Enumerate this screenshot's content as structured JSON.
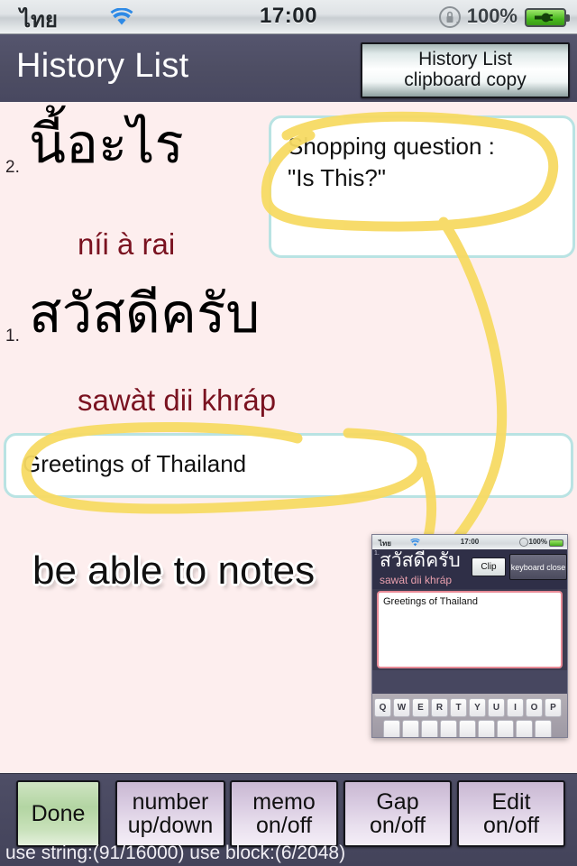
{
  "status_bar": {
    "language": "ไทย",
    "wifi_icon": "wifi-icon",
    "time": "17:00",
    "rotation_lock_icon": "rotation-lock-icon",
    "battery_percent": "100%",
    "battery_icon": "battery-charging-icon"
  },
  "nav": {
    "title": "History List",
    "clipboard_button_line1": "History List",
    "clipboard_button_line2": "clipboard copy"
  },
  "entries": [
    {
      "number": "2.",
      "thai": "นี้อะไร",
      "roman": "níi à rai",
      "memo": "Shopping question :\n\"Is This?\""
    },
    {
      "number": "1.",
      "thai": "สวัสดีครับ",
      "roman": "sawàt dii khráp",
      "memo": "Greetings of Thailand"
    }
  ],
  "annotation": {
    "handwritten_note": "be able to notes",
    "marker_color": "#f7da63",
    "memo_border_color": "#b9e3e3",
    "background_color": "#fdeeee",
    "roman_color": "#7a1220"
  },
  "inset": {
    "status_bar": {
      "language": "ไทย",
      "time": "17:00",
      "battery_percent": "100%"
    },
    "entry_number": "1.",
    "thai": "สวัสดีครับ",
    "roman": "sawàt dii khráp",
    "clip_button": "Clip",
    "keyboard_close_button": "keyboard close",
    "textarea_value": "Greetings of Thailand",
    "keyboard_row": [
      "Q",
      "W",
      "E",
      "R",
      "T",
      "Y",
      "U",
      "I",
      "O",
      "P"
    ]
  },
  "toolbar": {
    "buttons": [
      {
        "line1": "Done",
        "line2": "",
        "style": "done"
      },
      {
        "line1": "number",
        "line2": "up/down",
        "style": "plain"
      },
      {
        "line1": "memo",
        "line2": "on/off",
        "style": "plain"
      },
      {
        "line1": "Gap",
        "line2": "on/off",
        "style": "plain"
      },
      {
        "line1": "Edit",
        "line2": "on/off",
        "style": "plain"
      }
    ],
    "status_text": "use string:(91/16000) use block:(6/2048)"
  }
}
